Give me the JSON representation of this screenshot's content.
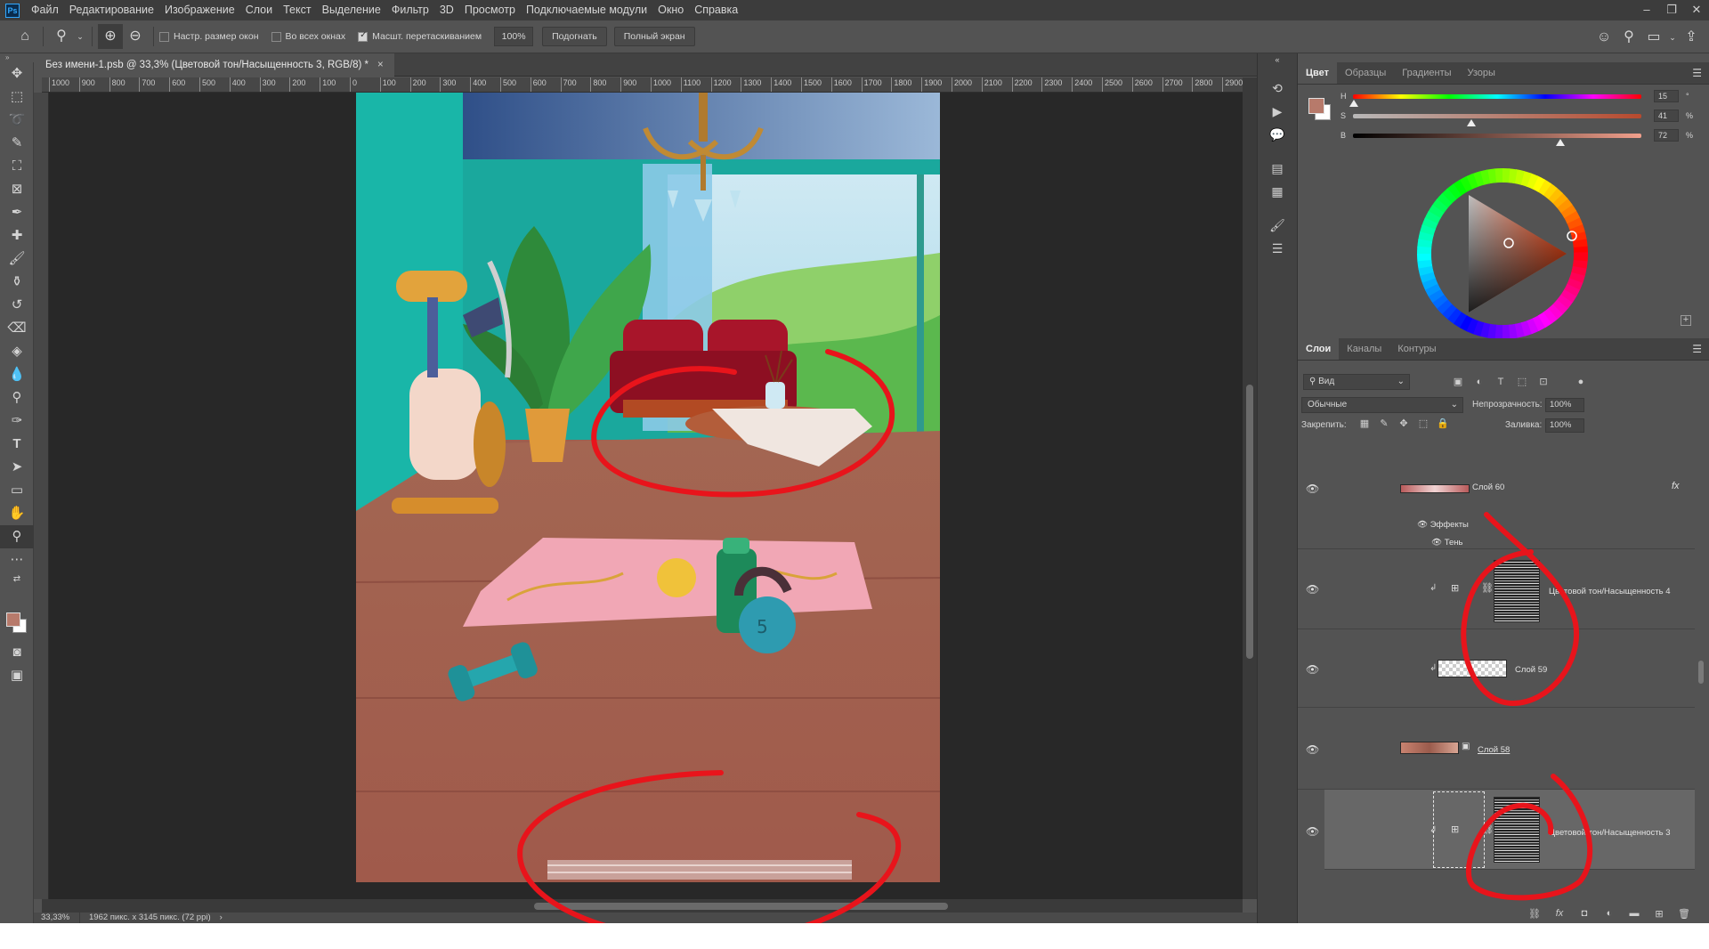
{
  "app": {
    "logo": "Ps",
    "menu": [
      "Файл",
      "Редактирование",
      "Изображение",
      "Слои",
      "Текст",
      "Выделение",
      "Фильтр",
      "3D",
      "Просмотр",
      "Подключаемые модули",
      "Окно",
      "Справка"
    ],
    "window_controls": [
      "–",
      "❐",
      "✕"
    ]
  },
  "options_bar": {
    "resize_windows_label": "Настр. размер окон",
    "resize_windows_checked": false,
    "all_windows_label": "Во всех окнах",
    "all_windows_checked": false,
    "scrubby_zoom_label": "Масшт. перетаскиванием",
    "scrubby_zoom_checked": true,
    "zoom_value": "100%",
    "fit_label": "Подогнать",
    "fullscreen_label": "Полный экран"
  },
  "document": {
    "tab_title": "Без имени-1.psb @ 33,3% (Цветовой тон/Насыщенность 3, RGB/8) *",
    "close": "×",
    "status_zoom": "33,33%",
    "status_info": "1962 пикс. x 3145 пикс. (72 ppi)"
  },
  "ruler_labels": [
    "1000",
    "900",
    "800",
    "700",
    "600",
    "500",
    "400",
    "300",
    "200",
    "100",
    "0",
    "100",
    "200",
    "300",
    "400",
    "500",
    "600",
    "700",
    "800",
    "900",
    "1000",
    "1100",
    "1200",
    "1300",
    "1400",
    "1500",
    "1600",
    "1700",
    "1800",
    "1900",
    "2000",
    "2100",
    "2200",
    "2300",
    "2400",
    "2500",
    "2600",
    "2700",
    "2800",
    "2900"
  ],
  "color_panel": {
    "tabs": [
      "Цвет",
      "Образцы",
      "Градиенты",
      "Узоры"
    ],
    "active_tab": "Цвет",
    "foreground": "#b77a6b",
    "background": "#ffffff",
    "h_label": "H",
    "h_value": "15",
    "h_unit": "°",
    "s_label": "S",
    "s_value": "41",
    "s_unit": "%",
    "b_label": "B",
    "b_value": "72",
    "b_unit": "%"
  },
  "layers_panel": {
    "tabs": [
      "Слои",
      "Каналы",
      "Контуры"
    ],
    "active_tab": "Слои",
    "filter_value": "Вид",
    "blend_mode": "Обычные",
    "opacity_label": "Непрозрачность:",
    "opacity_value": "100%",
    "lock_label": "Закрепить:",
    "fill_label": "Заливка:",
    "fill_value": "100%",
    "layers": [
      {
        "name": "Слой 60",
        "fx": "fx",
        "effects_label": "Эффекты",
        "effect": "Тень"
      },
      {
        "name": "Цветовой тон/Насыщенность 4"
      },
      {
        "name": "Слой 59"
      },
      {
        "name": "Слой 58"
      },
      {
        "name": "Цветовой тон/Насыщенность 3"
      }
    ]
  },
  "colors": {
    "ui_bg": "#535353",
    "canvas_bg": "#282828",
    "annotation_red": "#e8141b",
    "accent_blue": "#31a8ff"
  }
}
